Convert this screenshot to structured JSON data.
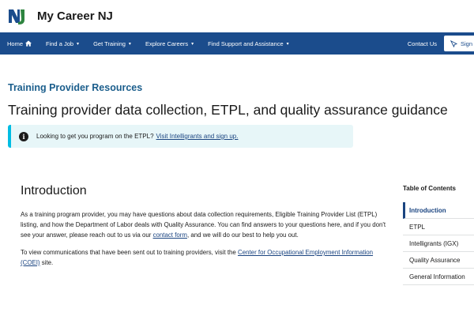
{
  "header": {
    "site_title": "My Career NJ",
    "logo_text": "NJ"
  },
  "nav": {
    "items": [
      {
        "label": "Home",
        "icon": "home-icon"
      },
      {
        "label": "Find a Job",
        "has_dropdown": true
      },
      {
        "label": "Get Training",
        "has_dropdown": true
      },
      {
        "label": "Explore Careers",
        "has_dropdown": true
      },
      {
        "label": "Find Support and Assistance",
        "has_dropdown": true
      }
    ],
    "contact_label": "Contact Us",
    "signin_label": "Sign In",
    "background_color": "#1b4c8c"
  },
  "page": {
    "eyebrow": "Training Provider Resources",
    "title": "Training provider data collection, ETPL, and quality assurance guidance"
  },
  "alert": {
    "text": "Looking to get you program on the ETPL?",
    "link_text": "Visit Intelligrants and sign up.",
    "accent_color": "#00bde3"
  },
  "intro": {
    "heading": "Introduction",
    "para1_before": "As a training program provider, you may have questions about data collection requirements, Eligible Training Provider List (ETPL) listing, and how the Department of Labor deals with Quality Assurance. You can find answers to your questions here, and if you don't see your answer, please reach out to us via our ",
    "para1_link": "contact form",
    "para1_after": ", and we will do our best to help you out.",
    "para2_before": "To view communications that have been sent out to training providers, visit the ",
    "para2_link": "Center for Occupational Employment Information (COEI)",
    "para2_after": " site."
  },
  "toc": {
    "title": "Table of Contents",
    "items": [
      {
        "label": "Introduction",
        "active": true
      },
      {
        "label": "ETPL"
      },
      {
        "label": "Intelligrants (IGX)"
      },
      {
        "label": "Quality Assurance"
      },
      {
        "label": "General Information"
      }
    ]
  }
}
